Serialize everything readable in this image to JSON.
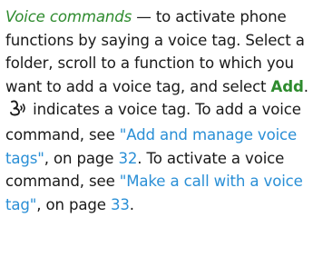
{
  "paragraph": {
    "term": "Voice commands",
    "dash_text": " — to activate phone functions by saying a voice tag. Select a folder, scroll to a function to which you want to add a voice tag, and select ",
    "add_label": "Add",
    "after_add": ". ",
    "icon_name": "voice-tag-icon",
    "after_icon": " indicates a voice tag. To add a voice command, see ",
    "link1": "\"Add and manage voice tags\"",
    "comma_on_page": ", on page ",
    "page1": "32",
    "after_page1": ". To activate a voice command, see ",
    "link2": "\"Make a call with a voice tag\"",
    "comma_on_page2": ", on page ",
    "page2": "33",
    "end": "."
  },
  "colors": {
    "green": "#2e8b2e",
    "link_blue": "#2a8fd6",
    "text": "#1a1a1a"
  }
}
